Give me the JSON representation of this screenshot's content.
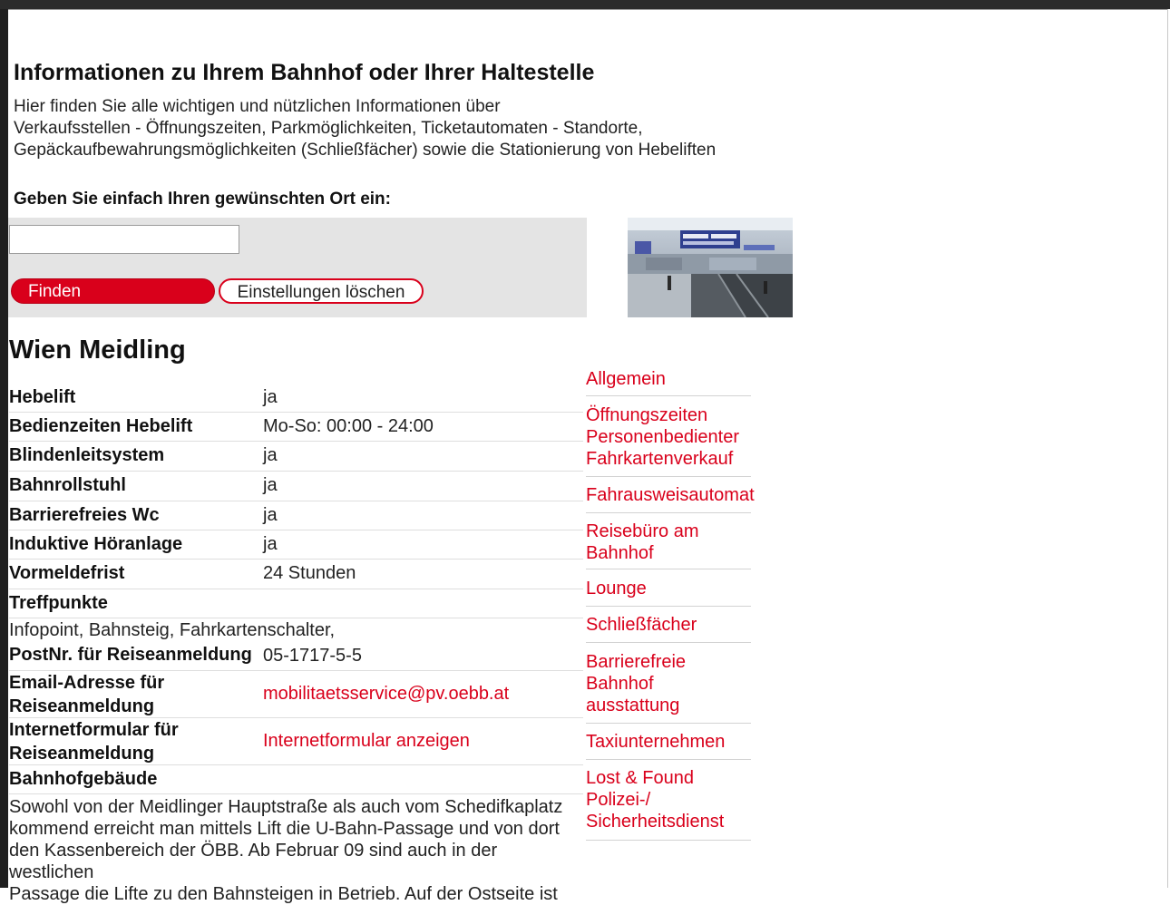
{
  "page": {
    "heading": "Informationen zu Ihrem Bahnhof oder Ihrer Haltestelle",
    "intro_lines": [
      "Hier finden Sie alle wichtigen und nützlichen Informationen über",
      "Verkaufsstellen - Öffnungszeiten, Parkmöglichkeiten, Ticketautomaten - Standorte,",
      "Gepäckaufbewahrungsmöglichkeiten (Schließfächer) sowie die Stationierung von Hebeliften"
    ],
    "prompt": "Geben Sie einfach Ihren gewünschten Ort ein:"
  },
  "search": {
    "value": "",
    "placeholder": "",
    "find_label": "Finden",
    "clear_label": "Einstellungen löschen"
  },
  "station": {
    "name": "Wien Meidling",
    "rows": [
      {
        "label": "Hebelift",
        "value": "ja"
      },
      {
        "label": "Bedienzeiten Hebelift",
        "value": "Mo-So: 00:00 - 24:00"
      },
      {
        "label": "Blindenleitsystem",
        "value": "ja"
      },
      {
        "label": "Bahnrollstuhl",
        "value": "ja"
      },
      {
        "label": "Barrierefreies Wc",
        "value": "ja"
      },
      {
        "label": "Induktive Höranlage",
        "value": "ja"
      },
      {
        "label": "Vormeldefrist",
        "value": "24 Stunden"
      },
      {
        "label": "Treffpunkte",
        "value": ""
      }
    ],
    "treffpunkte_text": "Infopoint, Bahnsteig, Fahrkartenschalter,",
    "postnr": {
      "label": "PostNr. für Reiseanmeldung",
      "value": "05-1717-5-5"
    },
    "email": {
      "label_lines": [
        "Email-Adresse für",
        "Reiseanmeldung"
      ],
      "value": "mobilitaetsservice@pv.oebb.at"
    },
    "form": {
      "label_lines": [
        "Internetformular für",
        "Reiseanmeldung"
      ],
      "value": "Internetformular anzeigen"
    },
    "building": {
      "label": "Bahnhofgebäude",
      "text_lines": [
        "Sowohl von der Meidlinger Hauptstraße als auch vom Schedifkaplatz",
        "kommend erreicht man mittels Lift die U-Bahn-Passage und von dort",
        "den Kassenbereich der ÖBB. Ab Februar 09 sind auch in der westlichen",
        "Passage die Lifte zu den Bahnsteigen in Betrieb. Auf der Ostseite ist"
      ]
    }
  },
  "sidenav": {
    "items": [
      {
        "lines": [
          "Allgemein"
        ]
      },
      {
        "lines": [
          "Öffnungszeiten",
          "Personenbedienter",
          "Fahrkartenverkauf"
        ]
      },
      {
        "lines": [
          "Fahrausweisautomat"
        ]
      },
      {
        "lines": [
          "Reisebüro am",
          "Bahnhof"
        ]
      },
      {
        "lines": [
          "Lounge"
        ]
      },
      {
        "lines": [
          "Schließfächer"
        ]
      },
      {
        "lines": [
          "Barrierefreie",
          "Bahnhof",
          "ausstattung"
        ]
      },
      {
        "lines": [
          "Taxiunternehmen"
        ]
      },
      {
        "lines": [
          "Lost & Found",
          "Polizei-/",
          "Sicherheitsdienst"
        ]
      }
    ]
  },
  "colors": {
    "accent_red": "#d9001b",
    "panel_gray": "#e4e4e4",
    "divider": "#dedede"
  },
  "icons": {
    "photo": "station-hall-photo"
  }
}
